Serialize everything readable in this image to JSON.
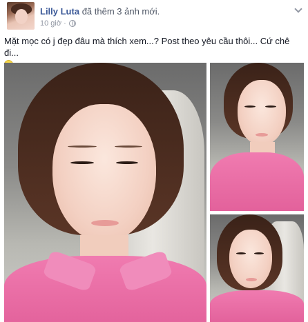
{
  "post": {
    "author": "Lilly Luta",
    "action": "đã thêm 3 ảnh mới.",
    "time": "10 giờ ·",
    "caption": "Mặt mọc có j đẹp đâu mà thích xem...? Post theo yêu cầu thôi... Cứ chê đi...",
    "privacy_icon": "globe-icon",
    "emoji_icon": "smiley-icon",
    "photo_count": 3
  },
  "colors": {
    "author_link": "#3b5998",
    "text": "#141823",
    "muted": "#9197a3",
    "shirt_pink": "#e96aa3"
  }
}
